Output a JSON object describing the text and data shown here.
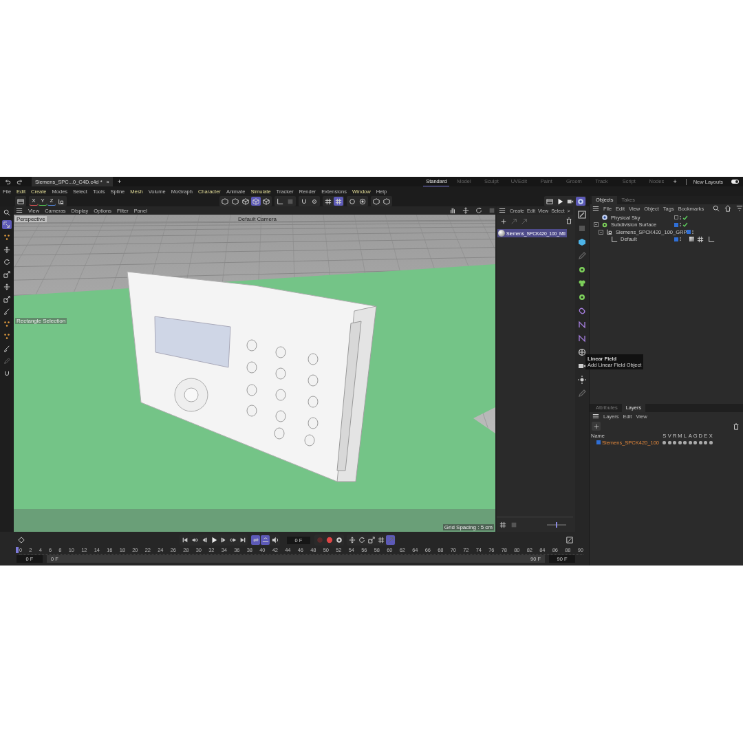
{
  "title_bar": {
    "document_tab": {
      "title": "Siemens_SPC...0_C4D.c4d *",
      "close": "×"
    },
    "new_tab": "+",
    "layouts": [
      {
        "label": "Standard",
        "selected": true
      },
      {
        "label": "Model",
        "selected": false
      },
      {
        "label": "Sculpt",
        "selected": false
      },
      {
        "label": "UVEdit",
        "selected": false
      },
      {
        "label": "Paint",
        "selected": false
      },
      {
        "label": "Groom",
        "selected": false
      },
      {
        "label": "Track",
        "selected": false
      },
      {
        "label": "Script",
        "selected": false
      },
      {
        "label": "Nodes",
        "selected": false
      }
    ],
    "add_layout": "+",
    "new_layouts": {
      "label": "New Layouts",
      "on": true
    }
  },
  "menu_bar": [
    {
      "label": "File",
      "highlighted": false
    },
    {
      "label": "Edit",
      "highlighted": true
    },
    {
      "label": "Create",
      "highlighted": true
    },
    {
      "label": "Modes",
      "highlighted": false
    },
    {
      "label": "Select",
      "highlighted": false
    },
    {
      "label": "Tools",
      "highlighted": false
    },
    {
      "label": "Spline",
      "highlighted": false
    },
    {
      "label": "Mesh",
      "highlighted": true
    },
    {
      "label": "Volume",
      "highlighted": false
    },
    {
      "label": "MoGraph",
      "highlighted": false
    },
    {
      "label": "Character",
      "highlighted": true
    },
    {
      "label": "Animate",
      "highlighted": false
    },
    {
      "label": "Simulate",
      "highlighted": true
    },
    {
      "label": "Tracker",
      "highlighted": false
    },
    {
      "label": "Render",
      "highlighted": false
    },
    {
      "label": "Extensions",
      "highlighted": false
    },
    {
      "label": "Window",
      "highlighted": true
    },
    {
      "label": "Help",
      "highlighted": false
    }
  ],
  "toolbar": {
    "axis_buttons": [
      "X",
      "Y",
      "Z"
    ],
    "display_modes": [
      {
        "selected": false
      },
      {
        "selected": false
      },
      {
        "selected": false
      },
      {
        "selected": true
      },
      {
        "selected": false
      }
    ],
    "snap_buttons": [
      {
        "selected": false
      },
      {
        "selected": true
      }
    ],
    "render_buttons": [
      {
        "selected": false
      },
      {
        "selected": false
      },
      {
        "selected": false
      },
      {
        "selected": true
      }
    ]
  },
  "tools": [
    {
      "selected": false
    },
    {
      "selected": true
    },
    {
      "selected": false
    },
    {
      "selected": false
    },
    {
      "selected": false
    },
    {
      "selected": false
    },
    {
      "selected": false
    },
    {
      "selected": false
    },
    {
      "selected": false
    },
    {
      "selected": false
    },
    {
      "selected": false
    },
    {
      "selected": false
    },
    {
      "selected": false
    },
    {
      "selected": false
    }
  ],
  "viewport": {
    "menu": [
      "View",
      "Cameras",
      "Display",
      "Options",
      "Filter",
      "Panel"
    ],
    "camera_label": "Perspective",
    "camera_name": "Default Camera",
    "tool_label": "Rectangle Selection",
    "grid_spacing": "Grid Spacing : 5 cm"
  },
  "material_manager": {
    "menu": [
      "Create",
      "Edit",
      "View",
      "Select",
      ">"
    ],
    "zoom_slider": {
      "level": 0.45
    },
    "materials": [
      {
        "name": "Siemens_SPCK420_100_Mtl",
        "selected": true
      }
    ]
  },
  "tooltip": {
    "title": "Linear Field",
    "description": "Add Linear Field Object"
  },
  "object_manager": {
    "tabs": [
      {
        "label": "Objects",
        "selected": true
      },
      {
        "label": "Takes",
        "selected": false
      }
    ],
    "menu": [
      "File",
      "Edit",
      "View",
      "Object",
      "Tags",
      "Bookmarks"
    ],
    "objects": [
      {
        "name": "Physical Sky",
        "checked": true
      },
      {
        "name": "Subdivision Surface",
        "color": "#2f6fd6",
        "checked": true,
        "expanded": true,
        "children": [
          {
            "name": "Siemens_SPCK420_100_GRP",
            "color": "#2f6fd6",
            "checked": false,
            "expanded": true,
            "children": [
              {
                "name": "Default",
                "color": "#2f6fd6",
                "checked": false
              }
            ]
          }
        ]
      }
    ]
  },
  "layer_manager": {
    "tabs": [
      {
        "label": "Attributes",
        "selected": false
      },
      {
        "label": "Layers",
        "selected": true
      }
    ],
    "menu": [
      "Layers",
      "Edit",
      "View"
    ],
    "columns": {
      "name": "Name",
      "flags": [
        "S",
        "V",
        "R",
        "M",
        "L",
        "A",
        "G",
        "D",
        "E",
        "X"
      ]
    },
    "layers": [
      {
        "name": "Siemens_SPCK420_100",
        "color": "#2f6fd6"
      }
    ]
  },
  "timeline": {
    "current_frame": "0 F",
    "transport_toggles": [
      {
        "selected": true
      },
      {
        "selected": true
      }
    ],
    "key_toggles": [
      {
        "selected": false
      },
      {
        "selected": false
      },
      {
        "selected": false
      },
      {
        "selected": false
      },
      {
        "selected": true
      }
    ],
    "frames": [
      "0",
      "2",
      "4",
      "6",
      "8",
      "10",
      "12",
      "14",
      "16",
      "18",
      "20",
      "22",
      "24",
      "26",
      "28",
      "30",
      "32",
      "34",
      "36",
      "38",
      "40",
      "42",
      "44",
      "46",
      "48",
      "50",
      "52",
      "54",
      "56",
      "58",
      "60",
      "62",
      "64",
      "66",
      "68",
      "70",
      "72",
      "74",
      "76",
      "78",
      "80",
      "82",
      "84",
      "86",
      "88",
      "90"
    ],
    "range": {
      "start": "0 F",
      "min": "0 F",
      "max": "90 F",
      "end": "90 F"
    }
  }
}
